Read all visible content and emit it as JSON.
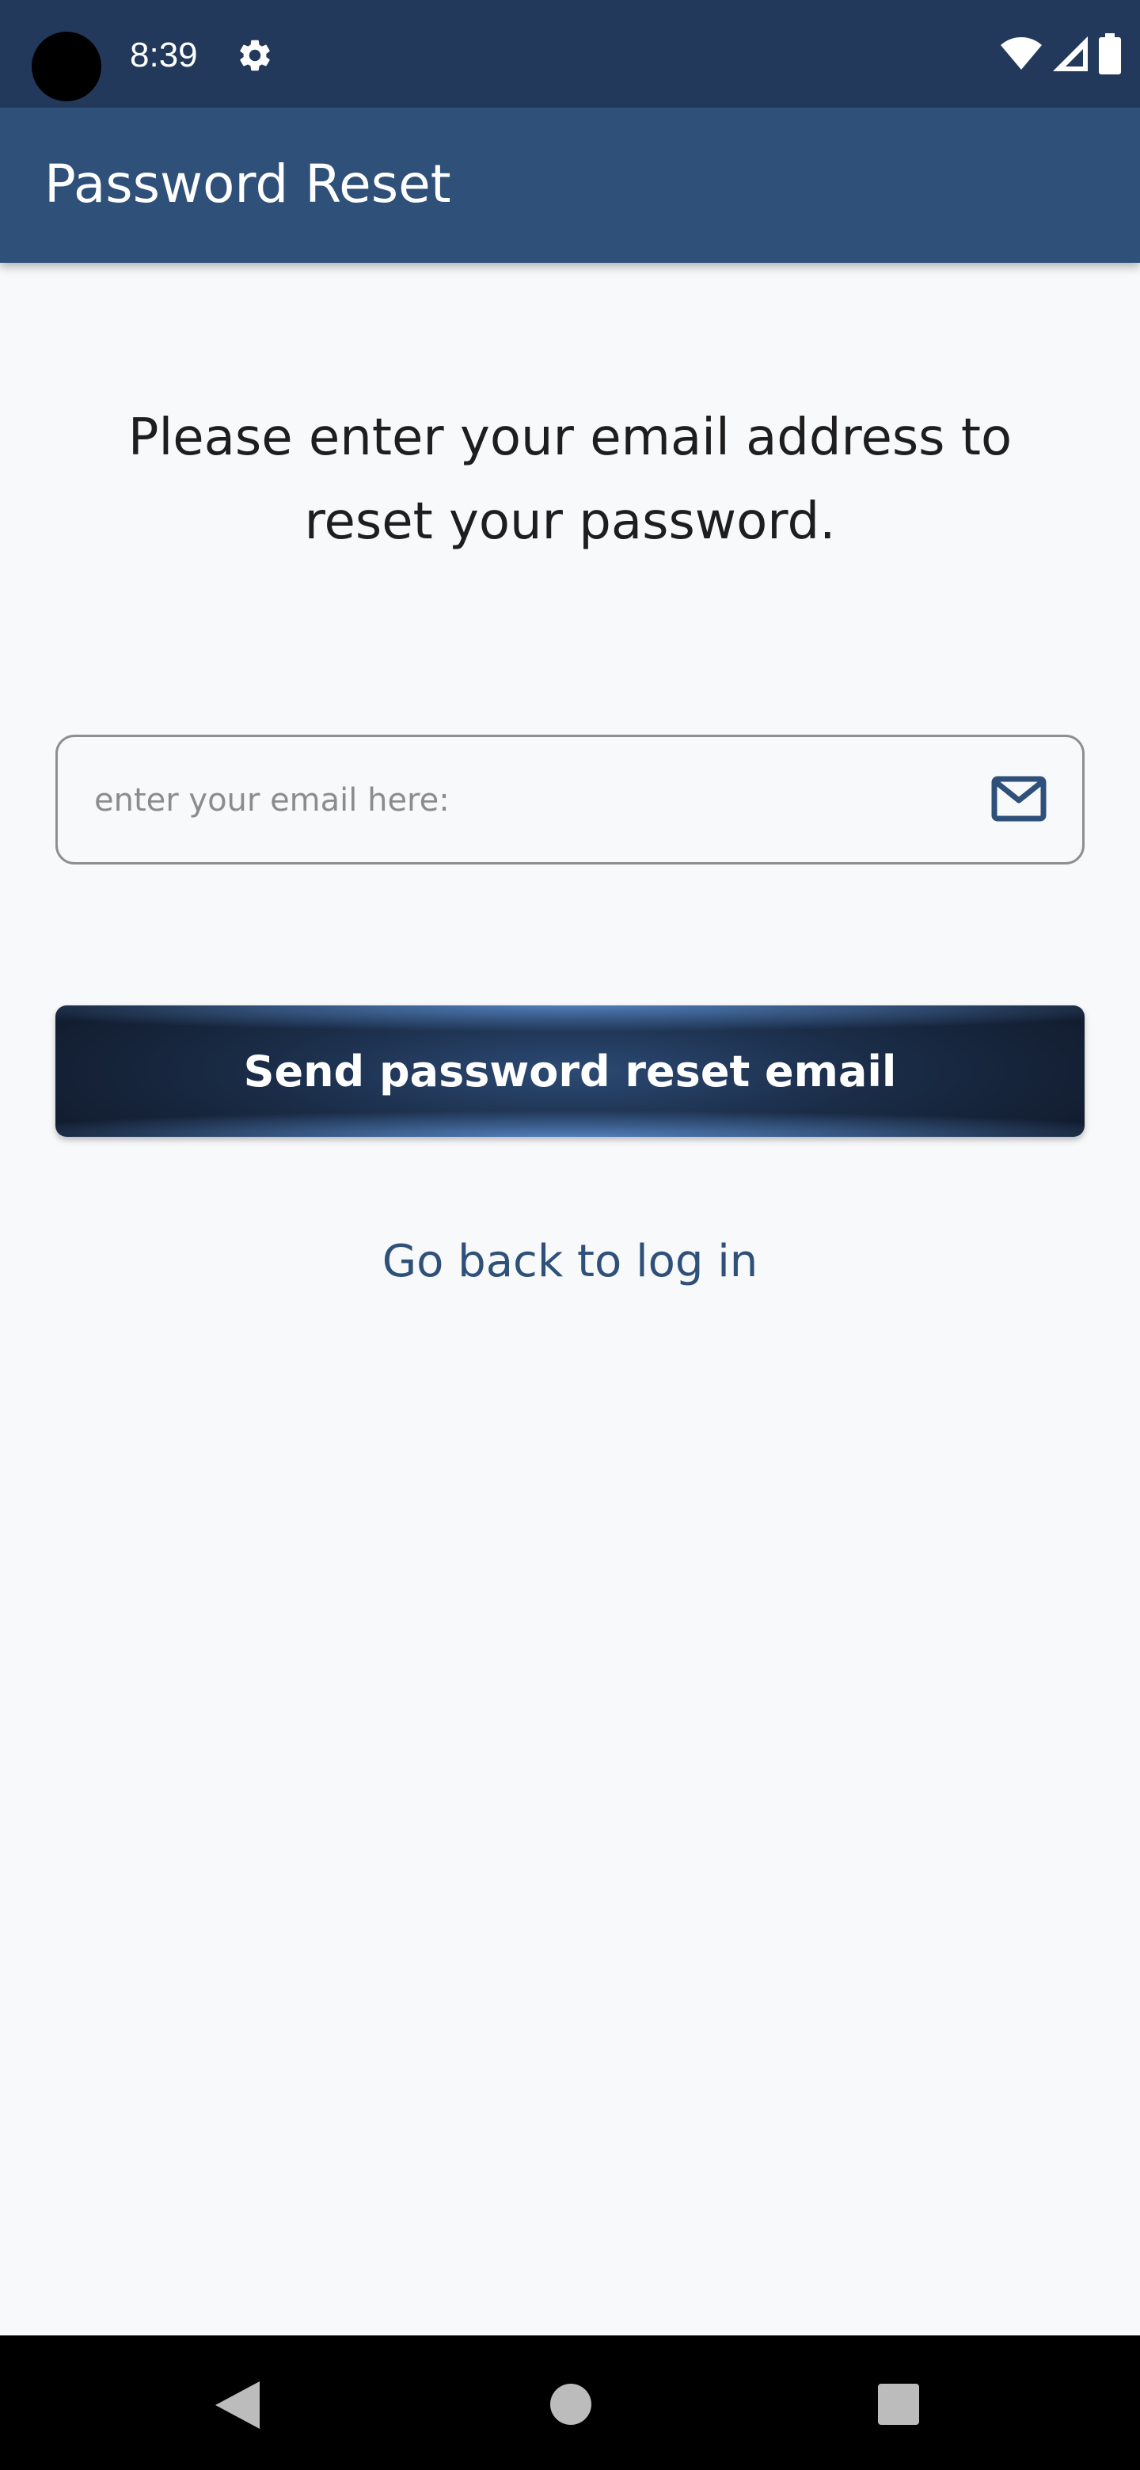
{
  "status_bar": {
    "time": "8:39",
    "icons": [
      "settings-icon",
      "wifi-icon",
      "signal-icon",
      "battery-icon"
    ],
    "background": "#22395b"
  },
  "app_bar": {
    "title": "Password Reset",
    "background": "#2e5079"
  },
  "content": {
    "instruction": "Please enter your email address to reset your password.",
    "email_field": {
      "value": "",
      "placeholder": "enter your email here:",
      "icon": "mail-icon"
    },
    "send_button_label": "Send password reset email",
    "back_link_label": "Go back to log in"
  },
  "nav_bar": {
    "buttons": [
      "back-icon",
      "home-icon",
      "recents-icon"
    ]
  },
  "colors": {
    "accent": "#2e5079",
    "button_dark": "#121d2f",
    "background": "#f8f9fb"
  }
}
